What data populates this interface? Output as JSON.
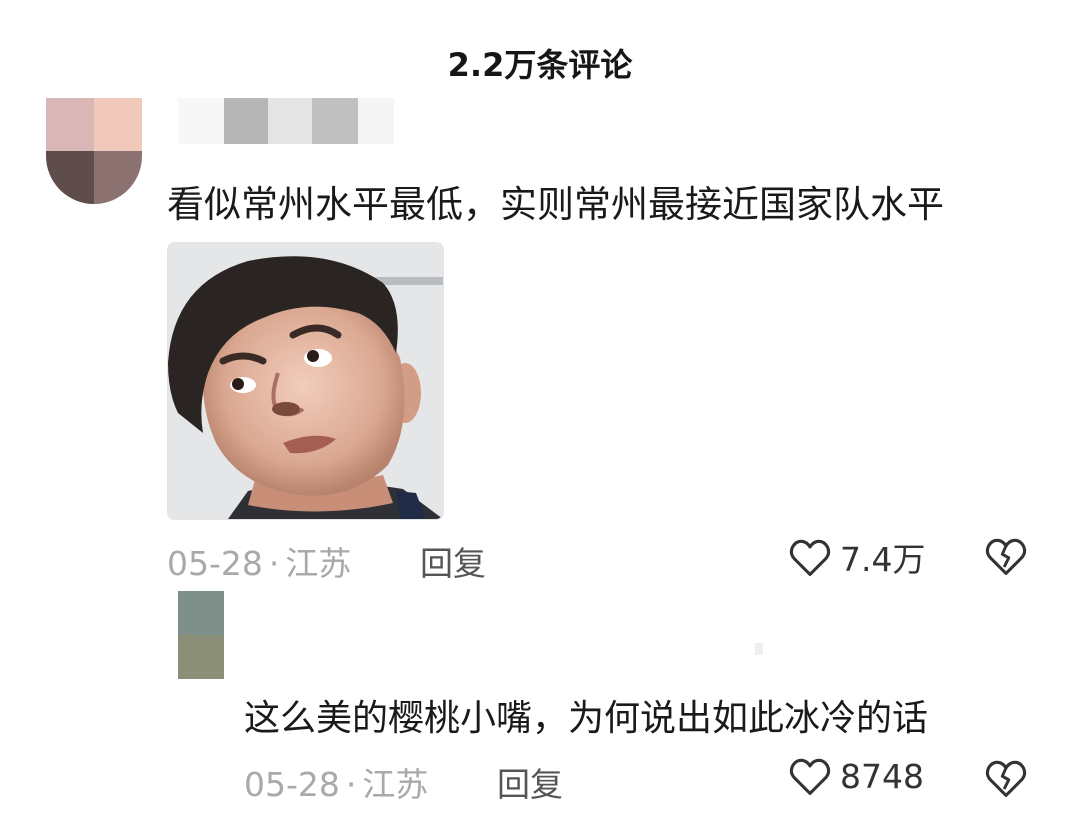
{
  "header": {
    "title": "2.2万条评论"
  },
  "comments": [
    {
      "text": "看似常州水平最低，实则常州最接近国家队水平",
      "date": "05-28",
      "location": "江苏",
      "separator": "·",
      "reply_label": "回复",
      "likes": "7.4万",
      "has_sticker": true
    },
    {
      "text": "这么美的樱桃小嘴，为何说出如此冰冷的话",
      "date": "05-28",
      "location": "江苏",
      "separator": "·",
      "reply_label": "回复",
      "likes": "8748"
    }
  ],
  "icons": {
    "like": "heart-outline-icon",
    "dislike": "broken-heart-icon"
  },
  "colors": {
    "meta_text": "#a9a9a9",
    "icon_stroke": "#333333"
  }
}
